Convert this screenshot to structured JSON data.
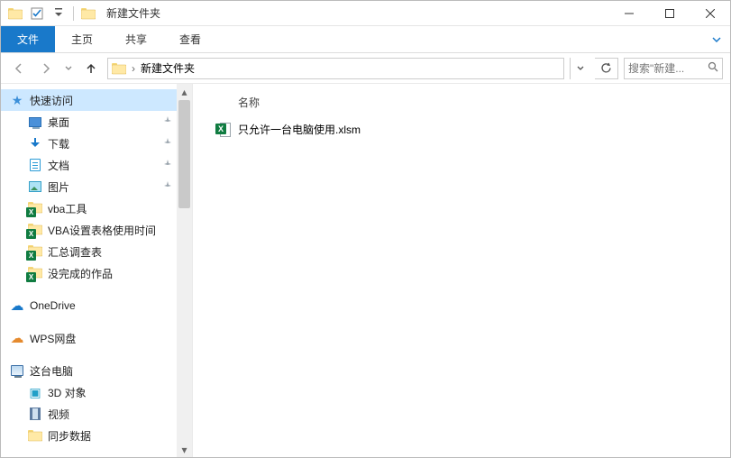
{
  "window": {
    "title": "新建文件夹"
  },
  "ribbon": {
    "tabs": {
      "file": "文件",
      "home": "主页",
      "share": "共享",
      "view": "查看"
    }
  },
  "address": {
    "path": "新建文件夹"
  },
  "search": {
    "placeholder": "搜索\"新建..."
  },
  "columns": {
    "name": "名称"
  },
  "sidebar": {
    "quick_access": "快速访问",
    "items": [
      {
        "label": "桌面",
        "pinned": true
      },
      {
        "label": "下载",
        "pinned": true
      },
      {
        "label": "文档",
        "pinned": true
      },
      {
        "label": "图片",
        "pinned": true
      },
      {
        "label": "vba工具",
        "pinned": false
      },
      {
        "label": "VBA设置表格使用时间",
        "pinned": false
      },
      {
        "label": "汇总调查表",
        "pinned": false
      },
      {
        "label": "没完成的作品",
        "pinned": false
      }
    ],
    "onedrive": "OneDrive",
    "wps": "WPS网盘",
    "thispc": "这台电脑",
    "pc_items": [
      {
        "label": "3D 对象"
      },
      {
        "label": "视频"
      },
      {
        "label": "同步数据"
      }
    ]
  },
  "files": [
    {
      "name": "只允许一台电脑使用.xlsm"
    }
  ]
}
